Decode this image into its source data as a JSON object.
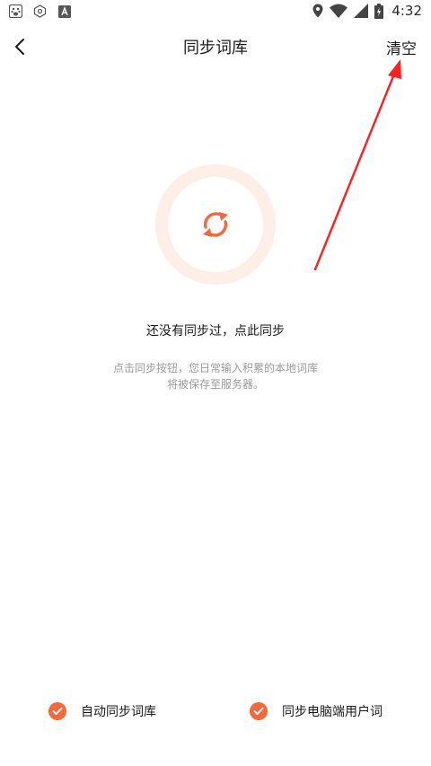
{
  "status_bar": {
    "time": "4:32",
    "icons": [
      "baidu-paw-icon",
      "hexagon-icon",
      "a-badge-icon",
      "location-icon",
      "wifi-icon",
      "signal-icon",
      "battery-icon"
    ]
  },
  "header": {
    "title": "同步词库",
    "clear_label": "清空"
  },
  "sync": {
    "message": "还没有同步过，点此同步",
    "desc_line1": "点击同步按钮，您日常输入积累的本地词库",
    "desc_line2": "将被保存至服务器。"
  },
  "options": [
    {
      "label": "自动同步词库",
      "checked": true
    },
    {
      "label": "同步电脑端用户词",
      "checked": true
    }
  ],
  "colors": {
    "accent": "#f4683a",
    "ring": "#fdeee7",
    "annotation": "#ff1f1f"
  }
}
